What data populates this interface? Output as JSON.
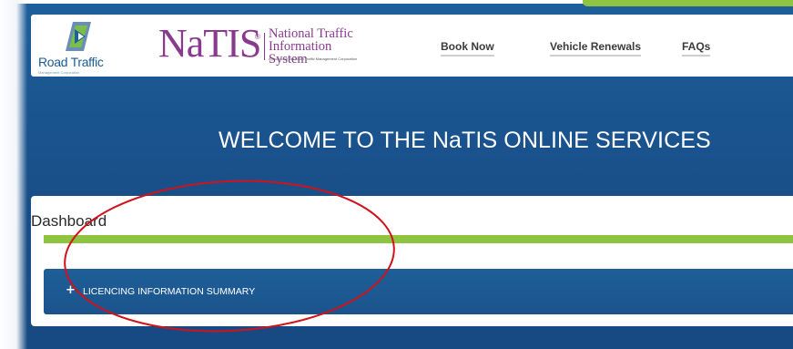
{
  "header": {
    "road_traffic_logo_text": "Road Traffic",
    "road_traffic_logo_sub": "Management Corporation",
    "natis_logo_word": "NaTIS",
    "natis_logo_reg": "®",
    "natis_logo_full": "National Traffic Information System",
    "natis_logo_product": "A product of the Road Traffic Management Corporation",
    "nav": [
      {
        "label": "Book Now"
      },
      {
        "label": "Vehicle Renewals"
      },
      {
        "label": "FAQs"
      }
    ]
  },
  "welcome": {
    "title": "WELCOME TO THE NaTIS ONLINE SERVICES"
  },
  "dashboard": {
    "title": "Dashboard",
    "accordion": {
      "icon": "plus-icon",
      "icon_glyph": "+",
      "label": "LICENCING INFORMATION SUMMARY"
    }
  },
  "colors": {
    "brand_blue": "#1a5590",
    "accent_green": "#8ec43f",
    "natis_purple": "#8a3a8e",
    "annotation_red": "#d0121b"
  }
}
